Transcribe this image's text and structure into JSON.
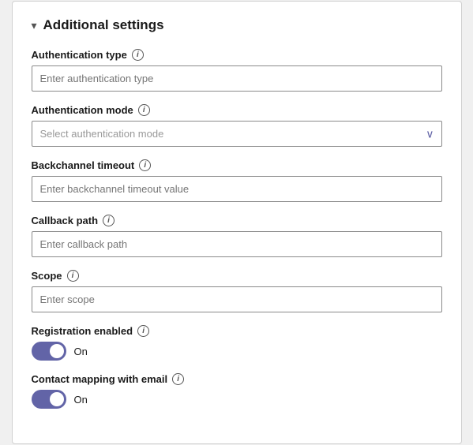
{
  "section": {
    "title": "Additional settings",
    "chevron": "▾"
  },
  "fields": {
    "auth_type": {
      "label": "Authentication type",
      "placeholder": "Enter authentication type"
    },
    "auth_mode": {
      "label": "Authentication mode",
      "placeholder": "Select authentication mode"
    },
    "backchannel_timeout": {
      "label": "Backchannel timeout",
      "placeholder": "Enter backchannel timeout value"
    },
    "callback_path": {
      "label": "Callback path",
      "placeholder": "Enter callback path"
    },
    "scope": {
      "label": "Scope",
      "placeholder": "Enter scope"
    },
    "registration_enabled": {
      "label": "Registration enabled",
      "toggle_label": "On"
    },
    "contact_mapping": {
      "label": "Contact mapping with email",
      "toggle_label": "On"
    }
  }
}
